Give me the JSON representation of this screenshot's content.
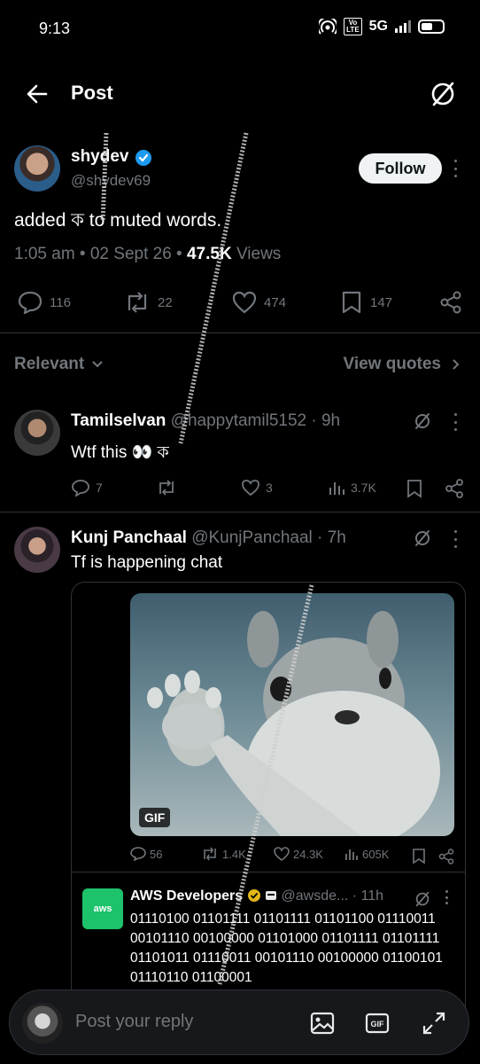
{
  "status_bar": {
    "time": "9:13",
    "volte_top": "Vo",
    "volte_bottom": "LTE",
    "network": "5G"
  },
  "header": {
    "title": "Post"
  },
  "main_tweet": {
    "author_name": "shydev",
    "author_handle": "@shydev69",
    "follow_label": "Follow",
    "text": "added ক to muted words.",
    "timestamp": "1:05 am • 02 Sept 26 •",
    "views_count": "47.5K",
    "views_label": " Views",
    "replies": "116",
    "reposts": "22",
    "likes": "474",
    "bookmarks": "147"
  },
  "sort_bar": {
    "relevant_label": "Relevant",
    "view_quotes_label": "View quotes"
  },
  "replies": [
    {
      "name": "Tamilselvan",
      "handle": "@happytamil5152",
      "time": " · 9h",
      "text": "Wtf this 👀 ক",
      "replies": "7",
      "reposts": "",
      "likes": "3",
      "views": "3.7K"
    },
    {
      "name": "Kunj Panchaal",
      "handle": "@KunjPanchaal",
      "time": " · 7h",
      "text": "Tf is happening chat",
      "quote": {
        "gif_badge": "GIF",
        "replies": "56",
        "reposts": "1.4K",
        "likes": "24.3K",
        "views": "605K",
        "nested": {
          "logo_text": "aws",
          "name": "AWS Developers",
          "handle": "@awsde...",
          "time": " · 11h",
          "text": "01110100 01101111 01101111 01101100 01110011 00101110 00100000 01101000 01101111 01101111 01101011 01110011 00101110 00100000 01100101 01110110 01100001"
        }
      }
    }
  ],
  "composer": {
    "placeholder": "Post your reply"
  },
  "colors": {
    "background": "#000000",
    "muted": "#71767b",
    "verified": "#1d9bf0",
    "aws_green": "#1ec26b"
  }
}
